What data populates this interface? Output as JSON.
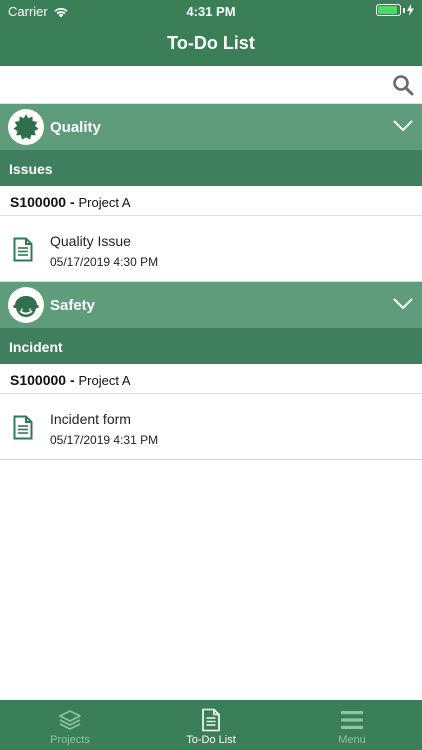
{
  "status_bar": {
    "carrier": "Carrier",
    "time": "4:31 PM",
    "battery_level": 0.9
  },
  "nav": {
    "title": "To-Do List"
  },
  "search": {
    "icon": "search-icon"
  },
  "sections": [
    {
      "category": "Quality",
      "icon": "badge-icon",
      "subheader": "Issues",
      "project_id": "S100000",
      "project_sep": "-",
      "project_name": "Project A",
      "item": {
        "title": "Quality Issue",
        "date": "05/17/2019 4:30 PM"
      }
    },
    {
      "category": "Safety",
      "icon": "hard-hat-icon",
      "subheader": "Incident",
      "project_id": "S100000",
      "project_sep": "-",
      "project_name": "Project A",
      "item": {
        "title": "Incident form",
        "date": "05/17/2019 4:31 PM"
      }
    }
  ],
  "tabs": [
    {
      "label": "Projects",
      "icon": "layers-icon",
      "active": false
    },
    {
      "label": "To-Do List",
      "icon": "document-icon",
      "active": true
    },
    {
      "label": "Menu",
      "icon": "hamburger-icon",
      "active": false
    }
  ],
  "colors": {
    "primary": "#3a7f58",
    "category": "#5e9c7c",
    "inactive_tab": "#8fc3a4"
  }
}
